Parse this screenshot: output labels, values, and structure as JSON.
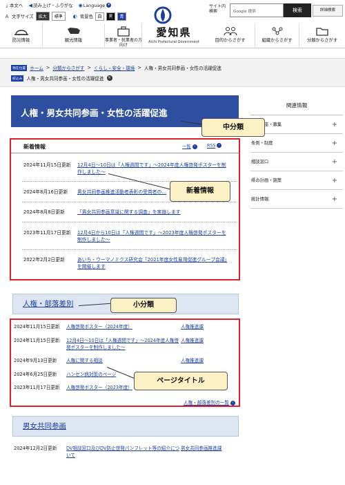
{
  "utility": {
    "home_text": "本文へ",
    "readaloud": "読み上げ・ふりがな",
    "language": "Language",
    "font_size_label": "文字サイズ",
    "font_large": "拡大",
    "font_standard": "標準",
    "bgcolor_label": "背景色",
    "bg_white": "白",
    "bg_black": "黒",
    "bg_blue": "青"
  },
  "brand": {
    "name": "愛知県",
    "name_en": "Aichi Prefectural Government"
  },
  "search": {
    "label": "サイト内検索",
    "placeholder": "Google 提供",
    "button": "検索",
    "advanced": "詳細検索"
  },
  "gnav": [
    {
      "label": "防災情報",
      "icon": "helmet-icon"
    },
    {
      "label": "観光情報",
      "icon": "cow-icon"
    },
    {
      "label": "事業者・就業者の方向け",
      "icon": "briefcase-icon"
    },
    {
      "label": "目的からさがす",
      "icon": "people-icon"
    },
    {
      "label": "組織からさがす",
      "icon": "org-icon"
    },
    {
      "label": "分類からさがす",
      "icon": "folder-icon"
    }
  ],
  "breadcrumb": {
    "tag1": "現在位置",
    "items": [
      "ホーム",
      "分類からさがす",
      "くらし・安全・環境",
      "人権・男女共同参画・女性の活躍促進"
    ],
    "tag2": "絞込み",
    "filter": "人権・男女共同参画・女性の活躍促進"
  },
  "page_title": "人権・男女共同参画・女性の活躍促進",
  "side": {
    "heading": "関連情報",
    "items": [
      "…・講座・募集",
      "条例・制度",
      "相談窓口",
      "県の計画・施策",
      "統計情報"
    ]
  },
  "news": {
    "heading": "新着情報",
    "list_link": "一覧",
    "rss_link": "RSS",
    "rows": [
      {
        "date": "2024年11月15日更新",
        "text": "12月4日～10日は「人権週間です」～2024年度人権啓発ポスターを制作しました～"
      },
      {
        "date": "2024年8月16日更新",
        "text": "男女共同参画推進活動者表彰の受賞者の…"
      },
      {
        "date": "2024年8月8日更新",
        "text": "「男女共同参画意識に関する調査」を実施します"
      },
      {
        "date": "2023年11月17日更新",
        "text": "12月4日から10日は「人権週間です」～2023年度人権啓発ポスターを制作しました～"
      },
      {
        "date": "2022年2月2日更新",
        "text": "あいち・ウーマノミクス研究会「2021年度女性雇用促進グループ会議」を開催します"
      }
    ]
  },
  "section1": {
    "title": "人権・部落差別",
    "rows": [
      {
        "date": "2024年11月15日更新",
        "text": "人権啓発ポスター（2024年度）",
        "cat": "人権推進課"
      },
      {
        "date": "2024年11月15日更新",
        "text": "12月4日～10日は「人権週間です」～2024年度人権啓発ポスターを制作しました～",
        "cat": "人権推進課"
      },
      {
        "date": "2024年9月13日更新",
        "text": "人権に関する相談",
        "cat": "人権推進課"
      },
      {
        "date": "2024年6月25日更新",
        "text": "ハンセン病対策のページ",
        "cat": ""
      },
      {
        "date": "2023年11月17日更新",
        "text": "人権啓発ポスター（2023年度）",
        "cat": "人権推進課"
      }
    ],
    "more": "人権・部落差別の一覧"
  },
  "section2": {
    "title": "男女共同参画",
    "rows": [
      {
        "date": "2024年12月2日更新",
        "text": "DV相談窓口及びDV防止啓発パンフレット等の紹介について",
        "cat": "男女共同参画推進課"
      }
    ]
  },
  "callouts": {
    "chubunrui": "中分類",
    "shinchaku": "新着情報",
    "shobunrui": "小分類",
    "page_title": "ページタイトル"
  },
  "colors": {
    "accent": "#1a3fa0",
    "title_bg": "#2e4ea0",
    "annotation": "#e0202b",
    "callout_bg": "#fbf1c4"
  }
}
